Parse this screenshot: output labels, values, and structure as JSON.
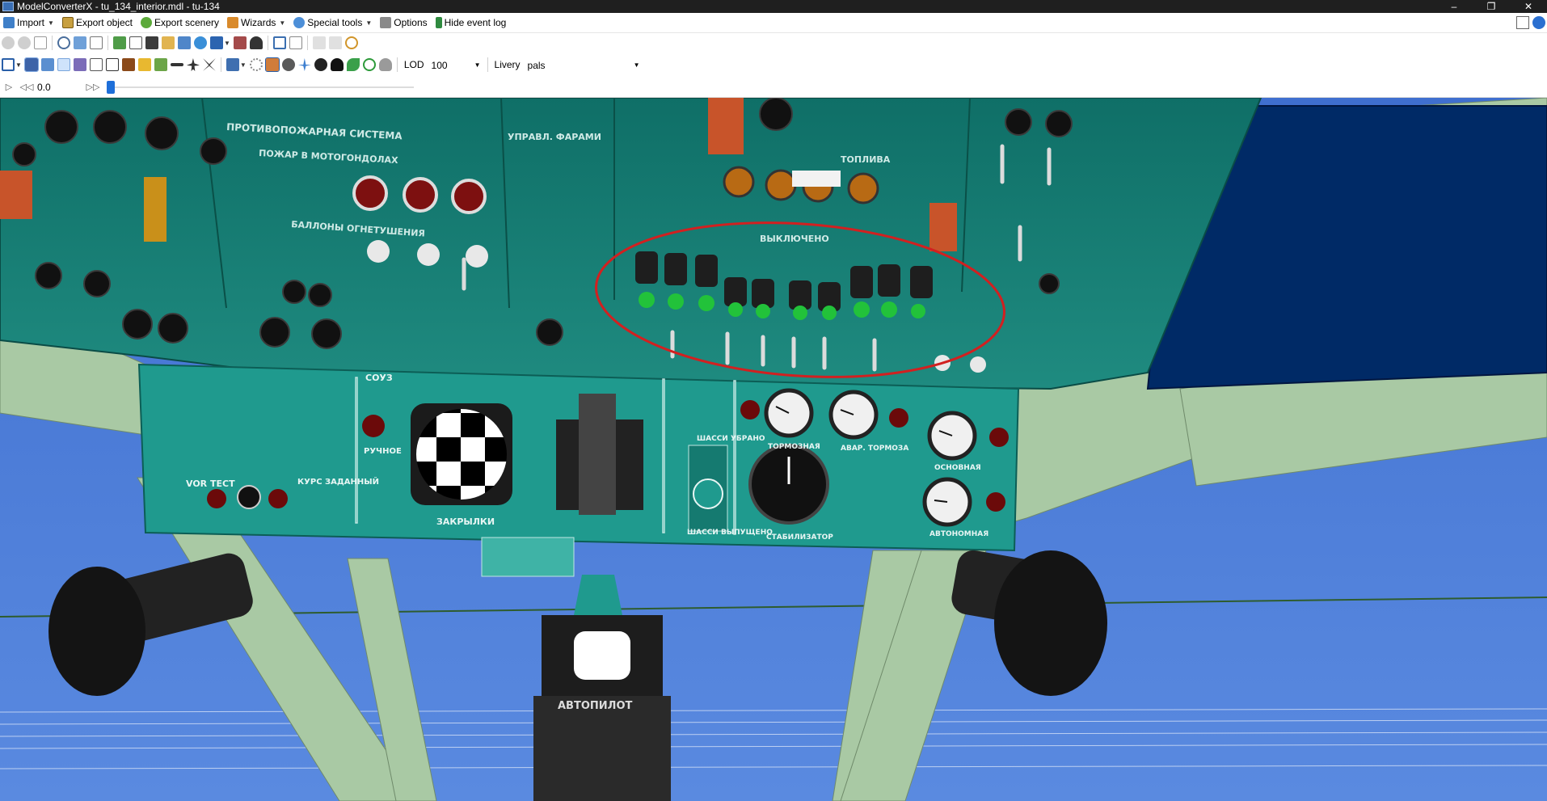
{
  "window": {
    "title": "ModelConverterX - tu_134_interior.mdl - tu-134",
    "controls": [
      "–",
      "❐",
      "✕"
    ]
  },
  "menu": {
    "items": [
      {
        "label": "Import",
        "icon": "import-icon",
        "has_dropdown": true
      },
      {
        "label": "Export object",
        "icon": "export-object-icon",
        "has_dropdown": false
      },
      {
        "label": "Export scenery",
        "icon": "export-scenery-icon",
        "has_dropdown": false
      },
      {
        "label": "Wizards",
        "icon": "wizard-icon",
        "has_dropdown": true
      },
      {
        "label": "Special tools",
        "icon": "special-tools-icon",
        "has_dropdown": true
      },
      {
        "label": "Options",
        "icon": "options-icon",
        "has_dropdown": false
      },
      {
        "label": "Hide event log",
        "icon": "event-log-icon",
        "has_dropdown": false
      }
    ]
  },
  "toolbar": {
    "lod_label": "LOD",
    "lod_value": "100",
    "livery_label": "Livery",
    "livery_value": "pals"
  },
  "animation": {
    "time_value": "0.0",
    "slider_position": 0
  },
  "viewport": {
    "scene": "Tu-134 cockpit overhead panel 3D preview",
    "panel_labels": {
      "fire_system": "ПРОТИВОПОЖАРНАЯ СИСТЕМА",
      "fire_nacelles": "ПОЖАР В МОТОГОНДОЛАХ",
      "fire_bottles": "БАЛЛОНЫ ОГНЕТУШЕНИЯ",
      "headlights": "УПРАВЛ. ФАРАМИ",
      "fuel": "ТОПЛИВА",
      "switched_off": "ВЫКЛЮЧЕНО",
      "flaps": "ЗАКРЫЛКИ",
      "gear_up": "ШАССИ УБРАНО",
      "gear_down": "ШАССИ ВЫПУЩЕНО",
      "brake": "ТОРМОЗНАЯ",
      "emergency_brake": "АВАР. ТОРМОЗА",
      "stabilizer": "СТАБИЛИЗАТОР",
      "main": "ОСНОВНАЯ",
      "autonomous": "АВТОНОМНАЯ",
      "autopilot": "АВТОПИЛОТ",
      "vor": "VOR",
      "test": "ТЕСТ",
      "course_set": "КУРС ЗАДАННЫЙ",
      "suz": "СОУЗ",
      "manual": "РУЧНОЕ"
    },
    "colors": {
      "sky": "#4e7fd6",
      "panel": "#1c8d83",
      "frame": "#a9c9a4",
      "highlight_ellipse": "#d22020"
    }
  }
}
